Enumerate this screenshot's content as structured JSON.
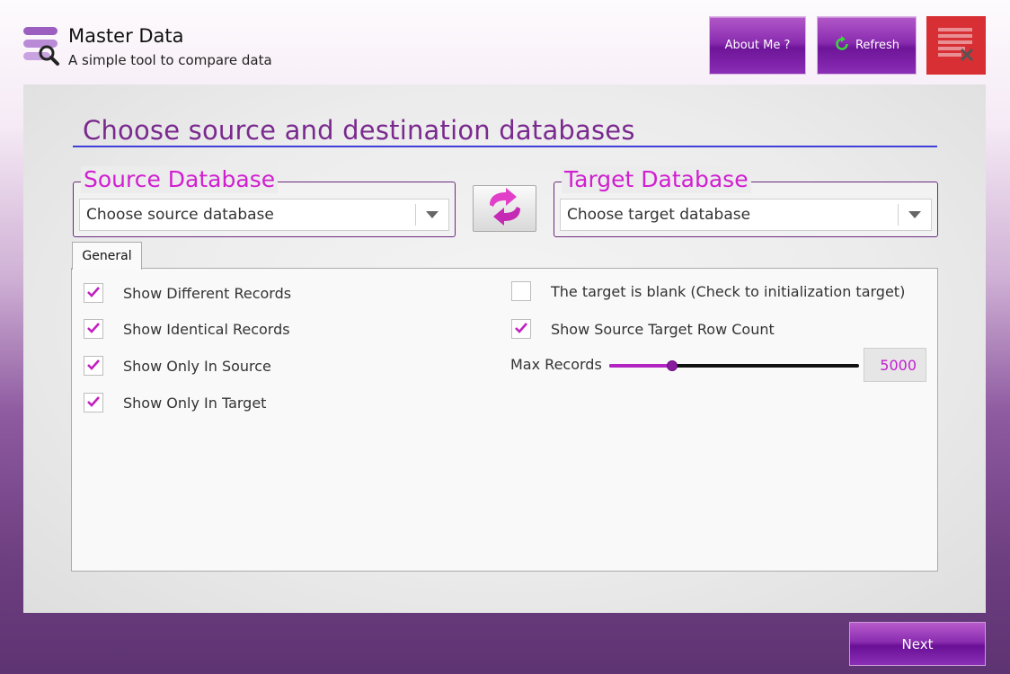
{
  "header": {
    "app_title": "Master Data",
    "app_subtitle": "A simple tool to compare data",
    "about_label": "About Me ?",
    "refresh_label": "Refresh"
  },
  "main": {
    "page_title": "Choose source and destination databases",
    "source": {
      "legend": "Source Database",
      "placeholder": "Choose source database"
    },
    "target": {
      "legend": "Target Database",
      "placeholder": "Choose target database"
    },
    "tabs": [
      {
        "label": "General",
        "selected": true
      }
    ],
    "left_options": [
      {
        "label": "Show Different Records",
        "checked": true
      },
      {
        "label": "Show Identical Records",
        "checked": true
      },
      {
        "label": "Show Only In Source",
        "checked": true
      },
      {
        "label": "Show Only In Target",
        "checked": true
      }
    ],
    "right_options": [
      {
        "label": "The target is blank (Check to initialization target)",
        "checked": false
      },
      {
        "label": "Show Source Target Row Count",
        "checked": true
      }
    ],
    "max_records": {
      "label": "Max Records",
      "value": "5000",
      "slider_fraction": 0.25
    }
  },
  "footer": {
    "next_label": "Next"
  },
  "colors": {
    "accent": "#d01fd0",
    "title": "#7a2a8e",
    "button": "#8a2cb0",
    "close": "#d82f35"
  }
}
